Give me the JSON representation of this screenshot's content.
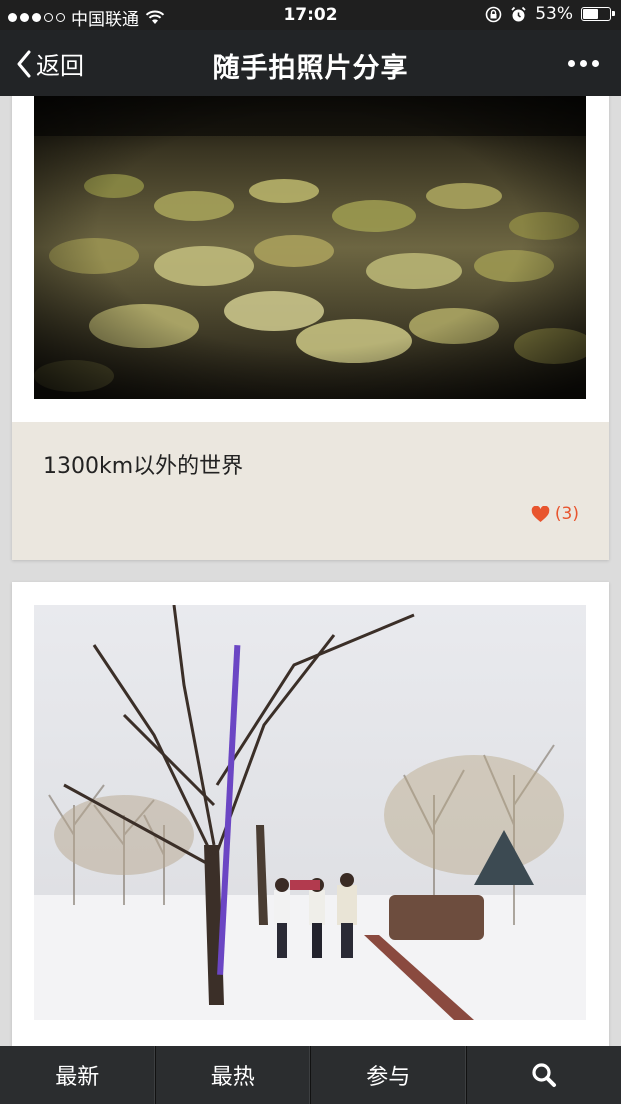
{
  "status_bar": {
    "carrier": "中国联通",
    "time": "17:02",
    "battery": "53%",
    "battery_level": 0.53
  },
  "nav": {
    "back_label": "返回",
    "title": "随手拍照片分享"
  },
  "posts": [
    {
      "title": "1300km以外的世界",
      "likes": "(3)",
      "image": "fallen yellow leaves on ground"
    },
    {
      "image": "snowy tree-lined path with people walking"
    }
  ],
  "tabs": [
    {
      "label": "最新"
    },
    {
      "label": "最热"
    },
    {
      "label": "参与"
    },
    {
      "label": "",
      "icon": "search-icon"
    }
  ],
  "colors": {
    "navbar": "#222426",
    "tabbar": "#2b2d2f",
    "caption_bg": "#ebe7df",
    "like_accent": "#e8552e"
  }
}
